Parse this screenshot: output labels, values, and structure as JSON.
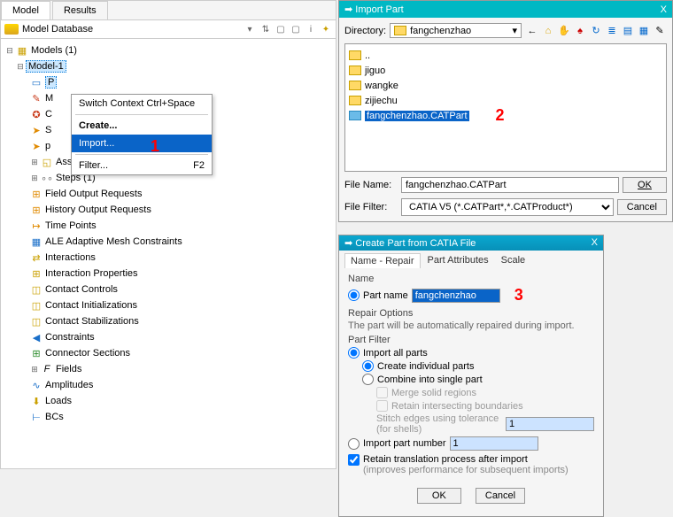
{
  "tabs": {
    "model": "Model",
    "results": "Results"
  },
  "database_label": "Model Database",
  "tree": {
    "models": "Models (1)",
    "model1": "Model-1",
    "parts_letter": "P",
    "m_letter": "M",
    "c_letter": "C",
    "s_letter": "S",
    "p_letter": "p",
    "assembly": "Assembly",
    "steps": "Steps (1)",
    "field_output": "Field Output Requests",
    "history_output": "History Output Requests",
    "time_points": "Time Points",
    "ale": "ALE Adaptive Mesh Constraints",
    "interactions": "Interactions",
    "interaction_props": "Interaction Properties",
    "contact_controls": "Contact Controls",
    "contact_init": "Contact Initializations",
    "contact_stab": "Contact Stabilizations",
    "constraints": "Constraints",
    "connector_sections": "Connector Sections",
    "fields": "Fields",
    "amplitudes": "Amplitudes",
    "loads": "Loads",
    "bcs": "BCs"
  },
  "context": {
    "switch": "Switch Context Ctrl+Space",
    "create": "Create...",
    "import": "Import...",
    "filter": "Filter...",
    "filter_key": "F2"
  },
  "annotations": {
    "one": "1",
    "two": "2",
    "three": "3"
  },
  "import_dialog": {
    "title": "Import Part",
    "close": "X",
    "directory_label": "Directory:",
    "directory_value": "fangchenzhao",
    "files": {
      "up": "..",
      "f1": "jiguo",
      "f2": "wangke",
      "f3": "zijiechu",
      "file": "fangchenzhao.CATPart"
    },
    "file_name_label": "File Name:",
    "file_name_value": "fangchenzhao.CATPart",
    "file_filter_label": "File Filter:",
    "file_filter_value": "CATIA V5 (*.CATPart*,*.CATProduct*)",
    "ok": "OK",
    "cancel": "Cancel"
  },
  "create_dialog": {
    "title": "Create Part from CATIA File",
    "close": "X",
    "tabs": {
      "name_repair": "Name - Repair",
      "part_attrs": "Part Attributes",
      "scale": "Scale"
    },
    "name_hdr": "Name",
    "part_name_label": "Part name",
    "part_name_value": "fangchenzhao",
    "repair_hdr": "Repair Options",
    "repair_desc": "The part will be automatically repaired during import.",
    "filter_hdr": "Part Filter",
    "import_all": "Import all parts",
    "create_individual": "Create individual parts",
    "combine": "Combine into single part",
    "merge_solid": "Merge solid regions",
    "retain_boundaries": "Retain intersecting boundaries",
    "stitch": "Stitch edges using tolerance (for shells)",
    "stitch_val": "1",
    "import_num": "Import part number",
    "import_num_val": "1",
    "retain_translation": "Retain translation process after import",
    "retain_sub": "(improves performance for subsequent imports)",
    "ok": "OK",
    "cancel": "Cancel"
  }
}
